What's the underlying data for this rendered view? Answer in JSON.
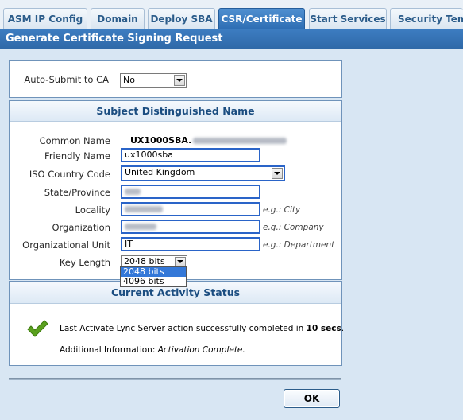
{
  "tabs": [
    {
      "label": "ASM IP Config"
    },
    {
      "label": "Domain"
    },
    {
      "label": "Deploy SBA"
    },
    {
      "label": "CSR/Certificate"
    },
    {
      "label": "Start Services"
    },
    {
      "label": "Security Templ"
    }
  ],
  "page": {
    "title": "Generate Certificate Signing Request"
  },
  "auto_submit": {
    "label": "Auto-Submit to CA",
    "value": "No"
  },
  "subject": {
    "heading": "Subject Distinguished Name",
    "common_name": {
      "label": "Common Name",
      "value": "UX1000SBA."
    },
    "friendly_name": {
      "label": "Friendly Name",
      "value": "ux1000sba"
    },
    "country": {
      "label": "ISO Country Code",
      "value": "United Kingdom"
    },
    "state": {
      "label": "State/Province"
    },
    "locality": {
      "label": "Locality",
      "hint": "e.g.: City"
    },
    "organization": {
      "label": "Organization",
      "hint": "e.g.: Company"
    },
    "org_unit": {
      "label": "Organizational Unit",
      "value": "IT",
      "hint": "e.g.: Department"
    },
    "key_length": {
      "label": "Key Length",
      "value": "2048 bits",
      "options": [
        "2048 bits",
        "4096 bits"
      ]
    }
  },
  "activity": {
    "heading": "Current Activity Status",
    "message_prefix": "Last Activate Lync Server action successfully completed in ",
    "message_bold": "10 secs",
    "message_suffix": ".",
    "info_label": "Additional Information: ",
    "info_value": "Activation Complete."
  },
  "ok_label": "OK",
  "colors": {
    "accent": "#2f6db3",
    "input_border": "#2a64c8",
    "check": "#5aa01e"
  }
}
